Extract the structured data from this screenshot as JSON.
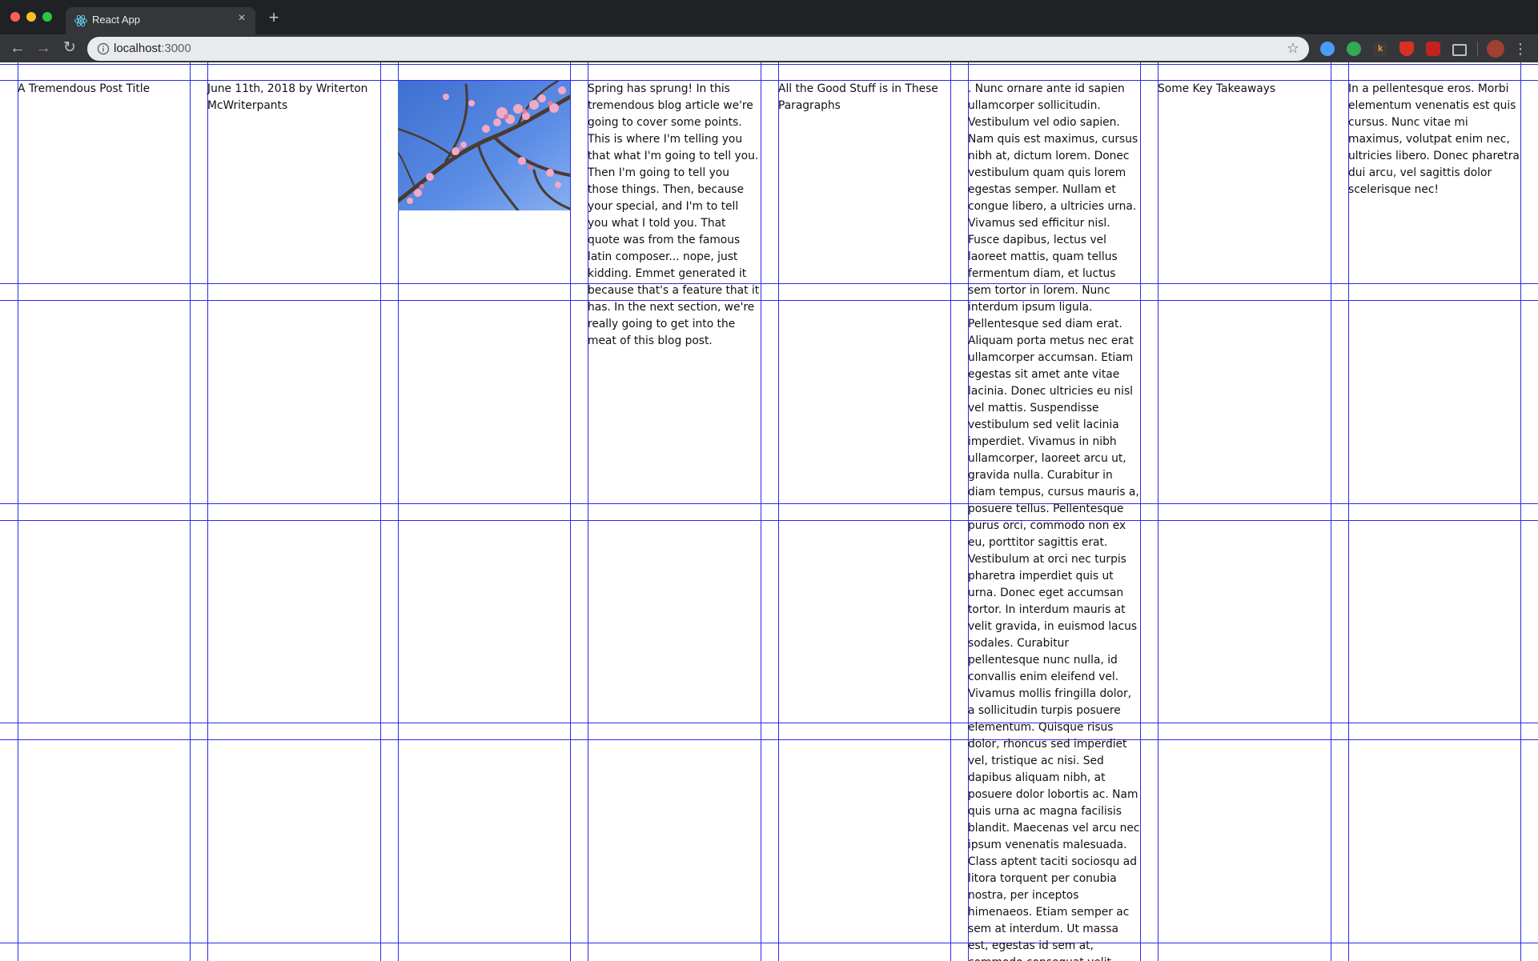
{
  "browser": {
    "tab": {
      "title": "React App",
      "close_label": "×"
    },
    "new_tab_label": "+",
    "nav": {
      "back": "←",
      "forward": "→",
      "reload": "↻"
    },
    "address_bar": {
      "host": "localhost",
      "port": ":3000"
    },
    "star": "☆",
    "menu": "⋮",
    "extensions": [
      {
        "icon": "extension-blue-icon",
        "label": ""
      },
      {
        "icon": "extension-green-icon",
        "label": ""
      },
      {
        "icon": "extension-k-icon",
        "label": "k"
      },
      {
        "icon": "extension-shield-icon",
        "label": ""
      },
      {
        "icon": "extension-red-icon",
        "label": ""
      },
      {
        "icon": "picture-in-picture-icon",
        "label": ""
      }
    ]
  },
  "post": {
    "title": "A Tremendous Post Title",
    "byline": "June 11th, 2018 by Writerton McWriterpants",
    "image_icon": "cherry-blossom-image",
    "intro": "Spring has sprung! In this tremendous blog article we're going to cover some points. This is where I'm telling you that what I'm going to tell you. Then I'm going to tell you those things. Then, because your special, and I'm to tell you what I told you. That quote was from the famous latin composer... nope, just kidding. Emmet generated it because that's a feature that it has. In the next section, we're really going to get into the meat of this blog post.",
    "section_heading": "All the Good Stuff is in These Paragraphs",
    "body": ". Nunc ornare ante id sapien ullamcorper sollicitudin. Vestibulum vel odio sapien. Nam quis est maximus, cursus nibh at, dictum lorem. Donec vestibulum quam quis lorem egestas semper. Nullam et congue libero, a ultricies urna. Vivamus sed efficitur nisl. Fusce dapibus, lectus vel laoreet mattis, quam tellus fermentum diam, et luctus sem tortor in lorem. Nunc interdum ipsum ligula. Pellentesque sed diam erat. Aliquam porta metus nec erat ullamcorper accumsan. Etiam egestas sit amet ante vitae lacinia. Donec ultricies eu nisl vel mattis. Suspendisse vestibulum sed velit lacinia imperdiet. Vivamus in nibh ullamcorper, laoreet arcu ut, gravida nulla. Curabitur in diam tempus, cursus mauris a, posuere tellus. Pellentesque purus orci, commodo non ex eu, porttitor sagittis erat. Vestibulum at orci nec turpis pharetra imperdiet quis ut urna. Donec eget accumsan tortor. In interdum mauris at velit gravida, in euismod lacus sodales. Curabitur pellentesque nunc nulla, id convallis enim eleifend vel. Vivamus mollis fringilla dolor, a sollicitudin turpis posuere elementum. Quisque risus dolor, rhoncus sed imperdiet vel, tristique ac nisi. Sed dapibus aliquam nibh, at posuere dolor lobortis ac. Nam quis urna ac magna facilisis blandit. Maecenas vel arcu nec ipsum venenatis malesuada. Class aptent taciti sociosqu ad litora torquent per conubia nostra, per inceptos himenaeos. Etiam semper ac sem at interdum. Ut massa est, egestas id sem at, commodo consequat velit.",
    "takeaways_heading": "Some Key Takeaways",
    "conclusion": "In a pellentesque eros. Morbi elementum venenatis est quis cursus. Nunc vitae mi maximus, volutpat enim nec, ultricies libero. Donec pharetra dui arcu, vel sagittis dolor scelerisque nec!"
  },
  "grid_overlay_color": "#2a2af0"
}
